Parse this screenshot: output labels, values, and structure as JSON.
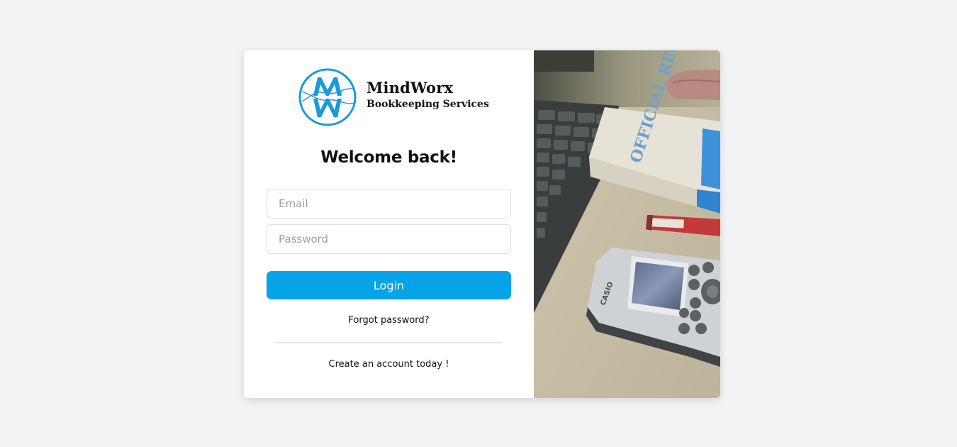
{
  "logo": {
    "brand": "MindWorx",
    "tagline": "Bookkeeping Services",
    "accent_color": "#1a9ad6"
  },
  "form": {
    "title": "Welcome back!",
    "email_placeholder": "Email",
    "password_placeholder": "Password",
    "login_label": "Login",
    "forgot_label": "Forgot password?",
    "create_label": "Create an account today !",
    "button_color": "#06a3e8"
  },
  "photo": {
    "book_text": "OFFICIAL RECORD BOOK",
    "calculator_brand": "CASIO"
  }
}
